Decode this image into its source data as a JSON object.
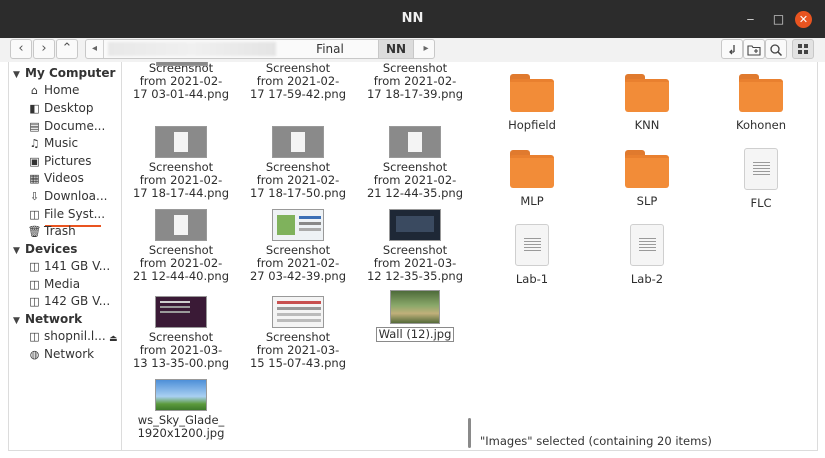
{
  "window": {
    "title": "NN"
  },
  "toolbar": {
    "back_glyph": "‹",
    "forward_glyph": "›",
    "up_glyph": "⌃",
    "crumb_prev": "◂",
    "crumb_next": "▸",
    "breadcrumbs": [
      "Final Semester",
      "NN"
    ],
    "icons": [
      "open-terminal-icon",
      "new-folder-icon",
      "search-icon",
      "grid-view-icon"
    ]
  },
  "sidebar": {
    "sections": [
      {
        "title": "My Computer",
        "items": [
          "Home",
          "Desktop",
          "Docume...",
          "Music",
          "Pictures",
          "Videos",
          "Downloa...",
          "File Syst...",
          "Trash"
        ]
      },
      {
        "title": "Devices",
        "items": [
          "141 GB V...",
          "Media",
          "142 GB V..."
        ]
      },
      {
        "title": "Network",
        "items": [
          "shopnil.l...",
          "Network"
        ]
      }
    ]
  },
  "left_pane": {
    "files": [
      [
        "Screenshot",
        "from 2021-02-",
        "17 03-01-44.png"
      ],
      [
        "Screenshot",
        "from 2021-02-",
        "17 17-59-42.png"
      ],
      [
        "Screenshot",
        "from 2021-02-",
        "17 18-17-39.png"
      ],
      [
        "Screenshot",
        "from 2021-02-",
        "17 18-17-44.png"
      ],
      [
        "Screenshot",
        "from 2021-02-",
        "17 18-17-50.png"
      ],
      [
        "Screenshot",
        "from 2021-02-",
        "21 12-44-35.png"
      ],
      [
        "Screenshot",
        "from 2021-02-",
        "21 12-44-40.png"
      ],
      [
        "Screenshot",
        "from 2021-02-",
        "27 03-42-39.png"
      ],
      [
        "Screenshot",
        "from 2021-03-",
        "12 12-35-35.png"
      ],
      [
        "Screenshot",
        "from 2021-03-",
        "13 13-35-00.png"
      ],
      [
        "Screenshot",
        "from 2021-03-",
        "15 15-07-43.png"
      ],
      [
        "Wall (12).jpg"
      ],
      [
        "ws_Sky_Glade_",
        "1920x1200.jpg"
      ]
    ]
  },
  "right_pane": {
    "folders": [
      "Hopfield",
      "KNN",
      "Kohonen",
      "MLP",
      "SLP"
    ],
    "documents": [
      "FLC",
      "Lab-1",
      "Lab-2"
    ],
    "status": "\"Images\" selected (containing 20 items)"
  },
  "colors": {
    "accent": "#e95420",
    "folder": "#f28c38",
    "titlebar": "#2c2c2c"
  }
}
